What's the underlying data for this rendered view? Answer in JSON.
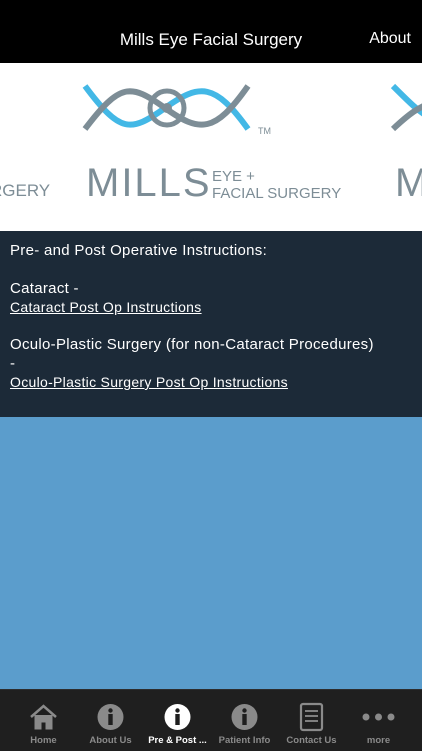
{
  "navbar": {
    "title": "Mills Eye Facial Surgery",
    "about_label": "About"
  },
  "banner": {
    "logo_left_partial": "RGERY",
    "logo_main": "MILLS",
    "logo_sub_line1": "EYE +",
    "logo_sub_line2": "FACIAL SURGERY",
    "logo_tm": "TM",
    "logo_right_partial": "M",
    "brand_blue": "#43b8e6",
    "brand_gray": "#7d8d96"
  },
  "content": {
    "heading": "Pre- and Post Operative Instructions:",
    "sections": [
      {
        "title": "Cataract -",
        "link": "Cataract Post Op Instructions"
      },
      {
        "title": "Oculo-Plastic Surgery (for non-Cataract Procedures)",
        "dash": "-",
        "link": "Oculo-Plastic Surgery Post Op Instructions"
      }
    ]
  },
  "tabbar": {
    "tabs": [
      {
        "label": "Home",
        "icon": "home-icon",
        "active": false
      },
      {
        "label": "About Us",
        "icon": "info-icon",
        "active": false
      },
      {
        "label": "Pre & Post ...",
        "icon": "info-icon",
        "active": true
      },
      {
        "label": "Patient Info",
        "icon": "info-icon",
        "active": false
      },
      {
        "label": "Contact Us",
        "icon": "document-icon",
        "active": false
      },
      {
        "label": "more",
        "icon": "more-icon",
        "active": false
      }
    ]
  },
  "colors": {
    "navbar_bg": "#000000",
    "content_bg": "#1c2a38",
    "page_bg": "#5b9dcc",
    "tabbar_bg": "#1f1f1f"
  }
}
